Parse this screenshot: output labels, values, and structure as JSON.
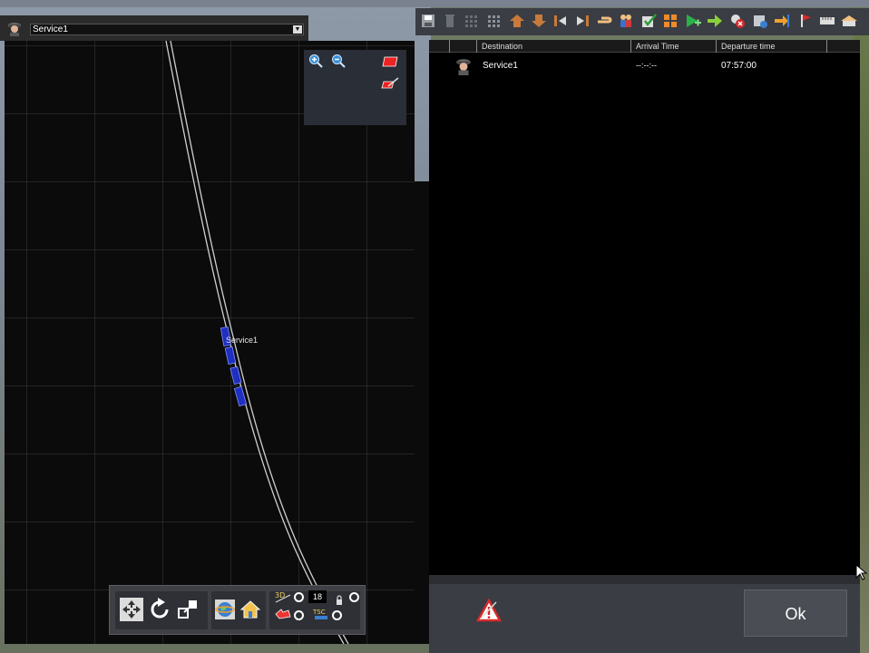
{
  "service_selector": {
    "selected": "Service1",
    "arrow": "▼"
  },
  "map": {
    "train_label": "Service1",
    "zoom_in_icon": "zoom-in-icon",
    "zoom_out_icon": "zoom-out-icon",
    "track_color": "#cfcfcf",
    "train_color": "#1f2fbf"
  },
  "bottom_toolbar": {
    "speed_value": "18",
    "icons": [
      "fit-view-icon",
      "rotate-icon",
      "zoom-to-icon",
      "globe-icon",
      "home-icon",
      "3d-icon",
      "camera-icon",
      "lock-icon",
      "tsc-icon"
    ]
  },
  "right_toolbar": {
    "icons": [
      "save-icon",
      "trash-icon",
      "grid-icon",
      "grid-alt-icon",
      "move-up-icon",
      "move-down-icon",
      "align-left-icon",
      "align-right-icon",
      "hand-icon",
      "people-icon",
      "check-list-icon",
      "grid-orange-icon",
      "add-green-icon",
      "add-arrow-icon",
      "remove-red-icon",
      "settings-icon",
      "import-icon",
      "flag-icon",
      "ruler-icon",
      "station-icon"
    ]
  },
  "timetable": {
    "columns": [
      "Destination",
      "Arrival Time",
      "Departure time"
    ],
    "rows": [
      {
        "destination": "Service1",
        "arrival": "--:--:--",
        "departure": "07:57:00"
      }
    ]
  },
  "footer": {
    "ok_label": "Ok"
  },
  "colors": {
    "accent_blue": "#1f2fbf",
    "panel_bg": "#3a3d44",
    "warning_red": "#d62a2a"
  }
}
